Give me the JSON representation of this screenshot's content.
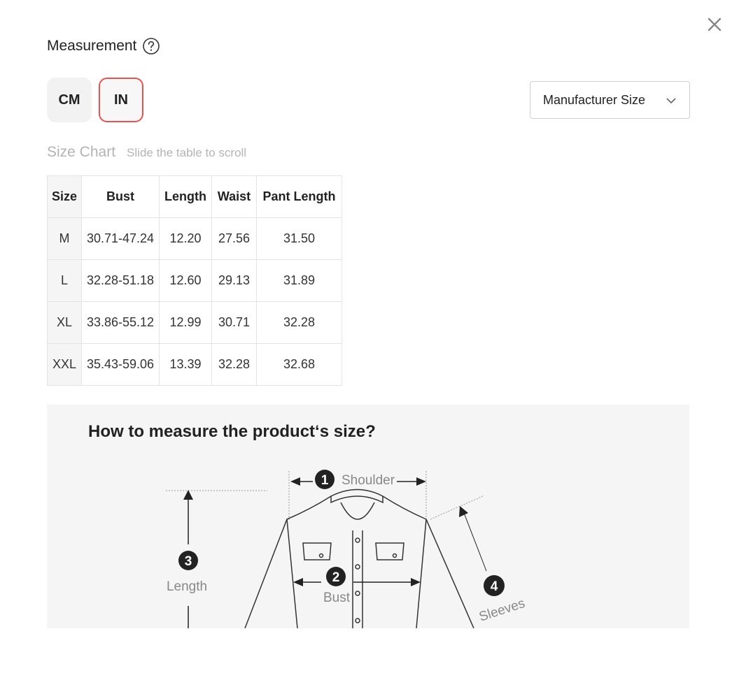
{
  "dialog": {
    "title": "Measurement",
    "help_icon": "question-circle-icon",
    "close_icon": "close-icon"
  },
  "units": [
    {
      "label": "CM",
      "selected": false
    },
    {
      "label": "IN",
      "selected": true
    }
  ],
  "size_select": {
    "value": "Manufacturer Size",
    "icon": "chevron-down-icon"
  },
  "size_chart": {
    "heading": "Size Chart",
    "hint": "Slide the table to scroll",
    "columns": [
      "Size",
      "Bust",
      "Length",
      "Waist",
      "Pant Length"
    ],
    "rows": [
      [
        "M",
        "30.71-47.24",
        "12.20",
        "27.56",
        "31.50"
      ],
      [
        "L",
        "32.28-51.18",
        "12.60",
        "29.13",
        "31.89"
      ],
      [
        "XL",
        "33.86-55.12",
        "12.99",
        "30.71",
        "32.28"
      ],
      [
        "XXL",
        "35.43-59.06",
        "13.39",
        "32.28",
        "32.68"
      ]
    ]
  },
  "guide": {
    "title": "How to measure the product‘s size?",
    "labels": [
      {
        "num": "1",
        "text": "Shoulder"
      },
      {
        "num": "2",
        "text": "Bust"
      },
      {
        "num": "3",
        "text": "Length"
      },
      {
        "num": "4",
        "text": "Sleeves"
      }
    ]
  },
  "colors": {
    "accent": "#e8524f",
    "muted_text": "#b4b4b4",
    "panel_bg": "#f5f5f5"
  }
}
